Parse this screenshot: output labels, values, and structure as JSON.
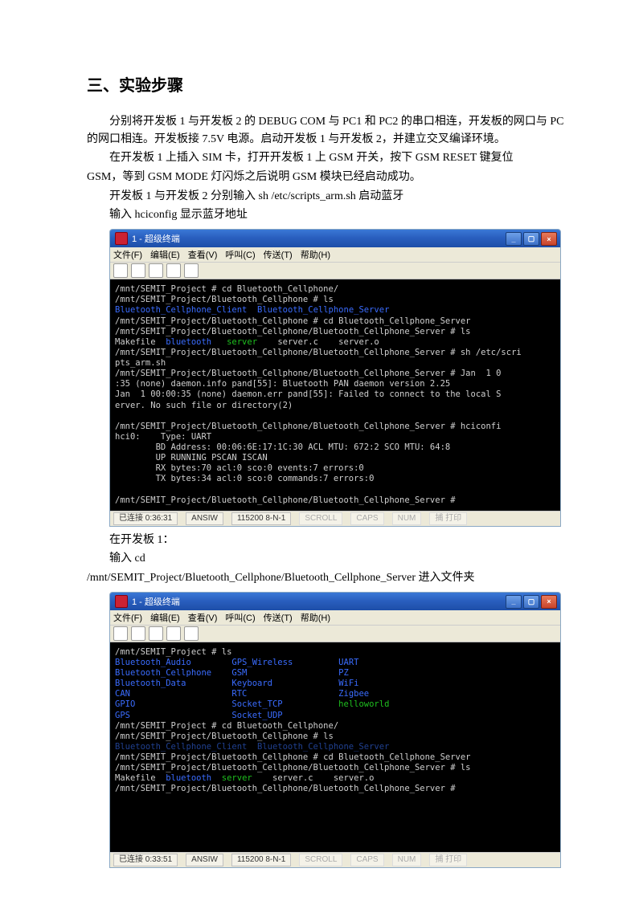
{
  "heading": "三、实验步骤",
  "para1": "分别将开发板 1 与开发板 2 的 DEBUG COM 与 PC1 和 PC2 的串口相连，开发板的网口与 PC 的网口相连。开发板接 7.5V 电源。启动开发板 1 与开发板 2，并建立交叉编译环境。",
  "para2a": "在开发板 1 上插入 SIM 卡，打开开发板 1 上 GSM 开关，按下 GSM RESET 键复位",
  "para2b": "GSM，等到 GSM MODE 灯闪烁之后说明 GSM 模块已经启动成功。",
  "para3": "开发板 1 与开发板 2 分别输入 sh /etc/scripts_arm.sh 启动蓝牙",
  "para4": "输入 hciconfig 显示蓝牙地址",
  "para5": "在开发板 1：",
  "para6": "输入 cd",
  "para7": "/mnt/SEMIT_Project/Bluetooth_Cellphone/Bluetooth_Cellphone_Server 进入文件夹",
  "term": {
    "title": "1 - 超级终端",
    "menu": [
      "文件(F)",
      "编辑(E)",
      "查看(V)",
      "呼叫(C)",
      "传送(T)",
      "帮助(H)"
    ],
    "status_connected": "已连接",
    "status_time1": "0:36:31",
    "status_time2": "0:33:51",
    "status_mode": "ANSIW",
    "status_baud": "115200 8-N-1",
    "status_scroll": "SCROLL",
    "status_caps": "CAPS",
    "status_num": "NUM",
    "status_hol": "捕 打印"
  },
  "console1": {
    "l1": "/mnt/SEMIT_Project # cd Bluetooth_Cellphone/",
    "l2": "/mnt/SEMIT_Project/Bluetooth_Cellphone # ls",
    "l3a": "Bluetooth_Cellphone_Client",
    "l3b": "Bluetooth_Cellphone_Server",
    "l4": "/mnt/SEMIT_Project/Bluetooth_Cellphone # cd Bluetooth_Cellphone_Server",
    "l5": "/mnt/SEMIT_Project/Bluetooth_Cellphone/Bluetooth_Cellphone_Server # ls",
    "l6a": "Makefile  ",
    "l6b": "bluetooth",
    "l6c": "   ",
    "l6d": "server",
    "l6e": "    server.c    server.o",
    "l7": "/mnt/SEMIT_Project/Bluetooth_Cellphone/Bluetooth_Cellphone_Server # sh /etc/scri",
    "l8": "pts_arm.sh",
    "l9": "/mnt/SEMIT_Project/Bluetooth_Cellphone/Bluetooth_Cellphone_Server # Jan  1 0",
    "l10": ":35 (none) daemon.info pand[55]: Bluetooth PAN daemon version 2.25",
    "l11": "Jan  1 00:00:35 (none) daemon.err pand[55]: Failed to connect to the local S",
    "l12": "erver. No such file or directory(2)",
    "l13": "/mnt/SEMIT_Project/Bluetooth_Cellphone/Bluetooth_Cellphone_Server # hciconfi",
    "l14": "hci0:    Type: UART",
    "l15": "        BD Address: 00:06:6E:17:1C:30 ACL MTU: 672:2 SCO MTU: 64:8",
    "l16": "        UP RUNNING PSCAN ISCAN",
    "l17": "        RX bytes:70 acl:0 sco:0 events:7 errors:0",
    "l18": "        TX bytes:34 acl:0 sco:0 commands:7 errors:0",
    "l19": "/mnt/SEMIT_Project/Bluetooth_Cellphone/Bluetooth_Cellphone_Server #"
  },
  "console2": {
    "l1": "/mnt/SEMIT_Project # ls",
    "r1a": "Bluetooth_Audio",
    "r1b": "GPS_Wireless",
    "r1c": "UART",
    "r2a": "Bluetooth_Cellphone",
    "r2b": "GSM",
    "r2c": "PZ",
    "r3a": "Bluetooth_Data",
    "r3b": "Keyboard",
    "r3c": "WiFi",
    "r4a": "CAN",
    "r4b": "RTC",
    "r4c": "Zigbee",
    "r5a": "GPIO",
    "r5b": "Socket_TCP",
    "r5c": "helloworld",
    "r6a": "GPS",
    "r6b": "Socket_UDP",
    "l7": "/mnt/SEMIT_Project # cd Bluetooth_Cellphone/",
    "l8": "/mnt/SEMIT_Project/Bluetooth_Cellphone # ls",
    "l8b": "Bluetooth_Cellphone_Client  Bluetooth_Cellphone_Server",
    "l9": "/mnt/SEMIT_Project/Bluetooth_Cellphone # cd Bluetooth_Cellphone_Server",
    "l10": "/mnt/SEMIT_Project/Bluetooth_Cellphone/Bluetooth_Cellphone_Server # ls",
    "l11a": "Makefile  ",
    "l11b": "bluetooth",
    "l11c": "  ",
    "l11d": "server",
    "l11e": "    server.c    server.o",
    "l12": "/mnt/SEMIT_Project/Bluetooth_Cellphone/Bluetooth_Cellphone_Server #"
  }
}
